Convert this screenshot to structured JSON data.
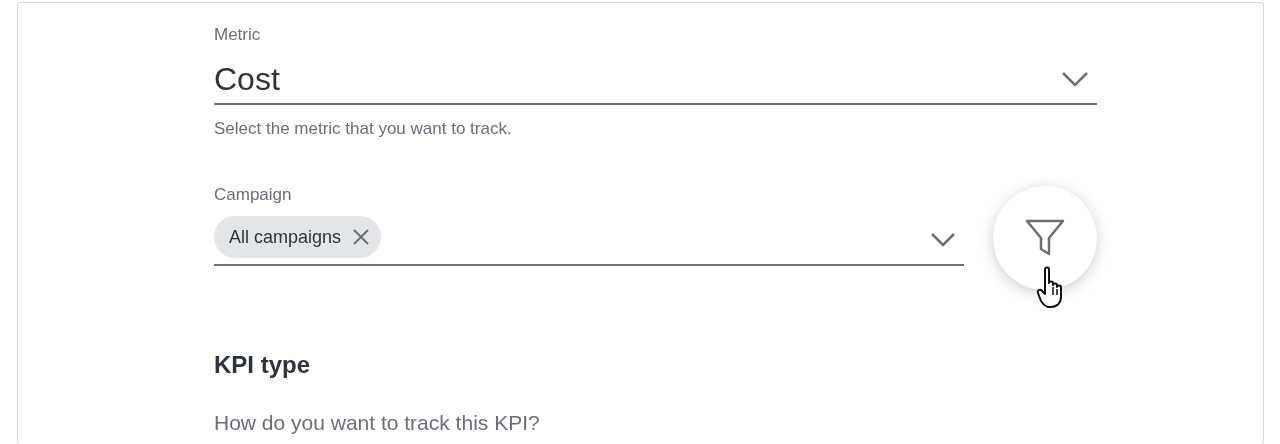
{
  "metric": {
    "label": "Metric",
    "value": "Cost",
    "helper": "Select the metric that you want to track."
  },
  "campaign": {
    "label": "Campaign",
    "chips": [
      {
        "label": "All campaigns"
      }
    ]
  },
  "kpi_type": {
    "heading": "KPI type",
    "question": "How do you want to track this KPI?"
  }
}
